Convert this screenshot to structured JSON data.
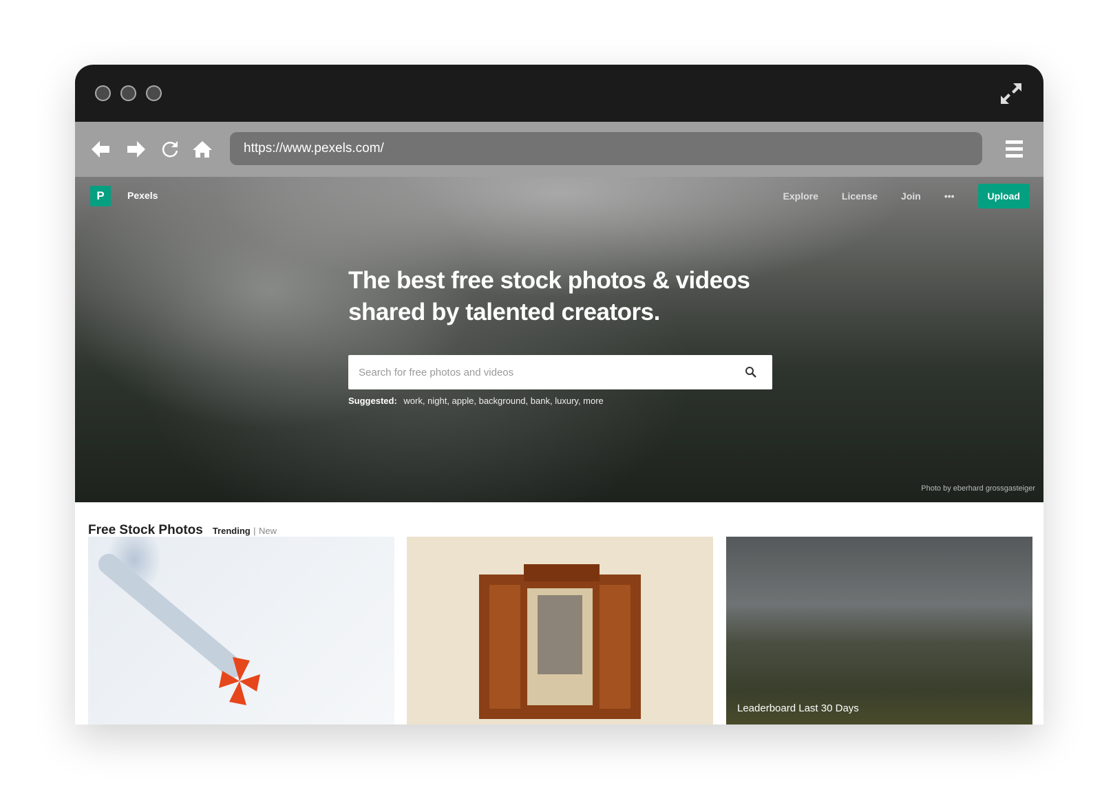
{
  "browser": {
    "url": "https://www.pexels.com/"
  },
  "site": {
    "brand": "Pexels",
    "logo_letter": "P",
    "nav": [
      "Explore",
      "License",
      "Join",
      "•••"
    ],
    "upload_label": "Upload",
    "accent": "#05a081"
  },
  "hero": {
    "title": "The best free stock photos & videos shared by talented creators.",
    "search_placeholder": "Search for free photos and videos",
    "suggested_label": "Suggested:",
    "suggestions": [
      "work",
      "night",
      "apple",
      "background",
      "bank",
      "luxury",
      "more"
    ],
    "credit": "Photo by eberhard grossgasteiger"
  },
  "section": {
    "title": "Free Stock Photos",
    "tab_trending": "Trending",
    "separator": "|",
    "tab_new": "New"
  },
  "photos": {
    "overlay_label": "Leaderboard Last 30 Days"
  }
}
